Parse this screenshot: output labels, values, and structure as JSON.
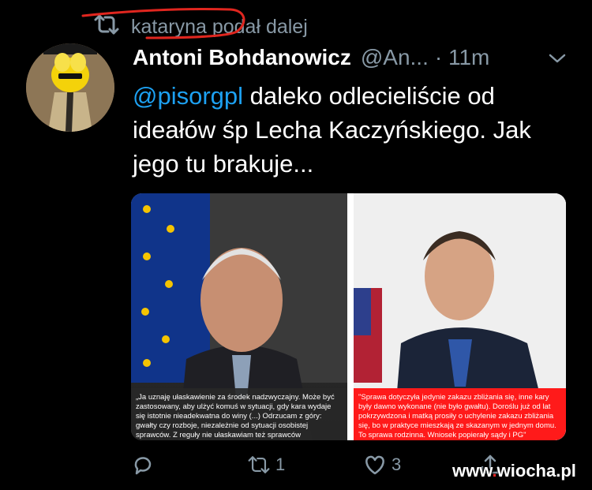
{
  "retweet": {
    "text": "kataryna podał dalej"
  },
  "tweet": {
    "name": "Antoni Bohdanowicz",
    "handle": "@An...",
    "time": "· 11m",
    "mention": "@pisorgpl",
    "text": " daleko odlecieliście od ideałów śp Lecha Kaczyńskiego. Jak jego tu brakuje...",
    "media": {
      "left_quote": "„Ja uznaję ułaskawienie za środek nadzwyczajny. Może być zastosowany, aby ulżyć komuś w sytuacji, gdy kara wydaje się istotnie nieadekwatna do winy (...) Odrzucam z góry: gwałty czy rozboje, niezależnie od sytuacji osobistej sprawców. Z reguły nie ułaskawiam też sprawców przestępstw przeciwko rodzinie.",
      "right_quote": "\"Sprawa dotyczyła jedynie zakazu zbliżania się, inne kary były dawno wykonane (nie było gwałtu). Doroślu już od lat pokrzywdzona i matką prosiły o uchylenie zakazu zbliżania się, bo w praktyce mieszkają ze skazanym w jednym domu. To sprawa rodzinna. Wniosek popierały sądy i PG\""
    }
  },
  "actions": {
    "retweet_count": "1",
    "like_count": "3"
  },
  "watermark": {
    "prefix": "www",
    "dot": ".",
    "site": "wiocha.pl"
  },
  "colors": {
    "accent": "#1da1f2",
    "muted": "#8899a6",
    "annotation": "#e0261f"
  }
}
